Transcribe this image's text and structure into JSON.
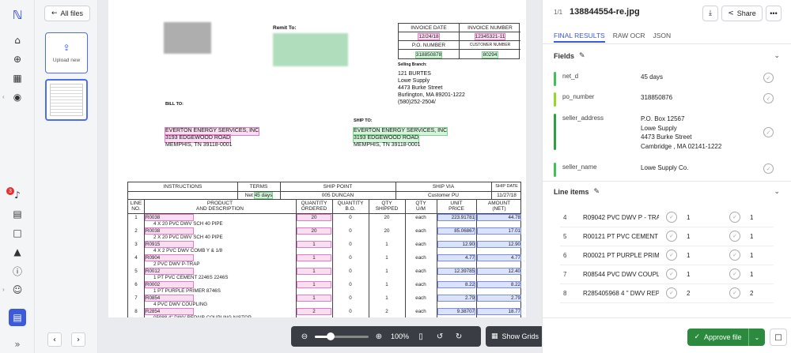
{
  "nav": {
    "notification_count": "3",
    "icons": [
      "logo-icon",
      "home-icon",
      "add-icon",
      "apps-icon",
      "compass-icon",
      "notification-icon",
      "book-icon",
      "feedback-icon",
      "rocket-icon",
      "help-icon",
      "account-icon",
      "document-icon",
      "expand-icon"
    ]
  },
  "files": {
    "all_files_label": "All files",
    "upload_label": "Upload new"
  },
  "toolbar": {
    "zoom_label": "100%",
    "zoom_level": 0.3,
    "show_grids_label": "Show Grids"
  },
  "document": {
    "remit_to_label": "Remit To:",
    "invoice_date_label": "INVOICE DATE",
    "invoice_number_label": "INVOICE NUMBER",
    "invoice_date": "12/24/18",
    "invoice_number": "12345321-11",
    "po_number_label": "P.O. NUMBER",
    "customer_number_label": "CUSTOMER NUMBER",
    "po_number": "318850878",
    "customer_number": "80294",
    "selling_branch_label": "Selling Branch:",
    "branch_lines": [
      "121 BURTES",
      "Lowe Supply",
      "4473  Burke Street",
      "Burlington, MA 89201-1222",
      "(580)252-2504/"
    ],
    "bill_to_label": "BILL TO:",
    "ship_to_label": "SHIP TO:",
    "bill_to_lines": [
      "EVERTON  ENERGY SERVICES, INC",
      "3193  EDGEWOOD ROAD",
      "MEMPHIS, TN 39118-0001"
    ],
    "ship_to_lines": [
      "EVERTON  ENERGY SERVICES, INC",
      "3193  EDGEWOOD ROAD",
      "MEMPHIS, TN 39118-0001"
    ],
    "header_row": {
      "instructions": "INSTRUCTIONS",
      "terms": "TERMS",
      "ship_point": "SHIP POINT",
      "ship_via": "SHIP VIA",
      "ship_date": "SHIP DATE",
      "terms_value_prefix": "Net ",
      "terms_value_days": "45 days",
      "ship_point_value": "005 DUNCAN",
      "ship_via_value": "Customer PU",
      "ship_date_value": "11/27/18"
    },
    "columns": {
      "line": "LINE\nNO.",
      "product": "PRODUCT\nAND DESCRIPTION",
      "qty_ordered": "QUANTITY\nORDERED",
      "qty_bo": "QUANTITY\nB.O.",
      "qty_shipped": "QTY\nSHIPPED",
      "qty_um": "QTY\nU/M",
      "unit_price": "UNIT\nPRICE",
      "amount": "AMOUNT\n(NET)"
    },
    "rows": [
      {
        "no": "1",
        "code": "R0038",
        "desc": "4 X 20 PVC DWV SCH 40 PIPE",
        "ordered": "20",
        "bo": "0",
        "shipped": "20",
        "um": "each",
        "price": "223.91781",
        "amount": "44.78"
      },
      {
        "no": "2",
        "code": "R0038",
        "desc": "2 X 20 PVC DWV SCH 40 PIPE",
        "ordered": "20",
        "bo": "0",
        "shipped": "20",
        "um": "each",
        "price": "85.06867",
        "amount": "17.01"
      },
      {
        "no": "3",
        "code": "R0915",
        "desc": "4 X 2 PVC DWV COMB Y & 1/8",
        "ordered": "1",
        "bo": "0",
        "shipped": "1",
        "um": "each",
        "price": "12.90",
        "amount": "12.90"
      },
      {
        "no": "4",
        "code": "R0904",
        "desc": "2 PVC DWV P-TRAP",
        "ordered": "1",
        "bo": "0",
        "shipped": "1",
        "um": "each",
        "price": "4.77",
        "amount": "4.77"
      },
      {
        "no": "5",
        "code": "R0012",
        "desc": "1 PT PVC CEMENT 2246S 2246S",
        "ordered": "1",
        "bo": "0",
        "shipped": "1",
        "um": "each",
        "price": "12.39785",
        "amount": "12.40"
      },
      {
        "no": "6",
        "code": "R0002",
        "desc": "1 PT PURPLE PRIMER 8746S",
        "ordered": "1",
        "bo": "0",
        "shipped": "1",
        "um": "each",
        "price": "8.22",
        "amount": "8.22"
      },
      {
        "no": "7",
        "code": "R0854",
        "desc": "4 PVC DWV COUPLING",
        "ordered": "1",
        "bo": "0",
        "shipped": "1",
        "um": "each",
        "price": "2.79",
        "amount": "2.79"
      },
      {
        "no": "8",
        "code": "R2854",
        "desc": "05988 4\" DWV REPAIR COUPLING N/STOP",
        "ordered": "2",
        "bo": "0",
        "shipped": "2",
        "um": "each",
        "price": "9.38707",
        "amount": "18.77"
      }
    ]
  },
  "panel": {
    "page_counter": "1/1",
    "file_name": "138844554-re.jpg",
    "share_label": "Share",
    "tabs": [
      "FINAL RESULTS",
      "RAW OCR",
      "JSON"
    ],
    "fields_title": "Fields",
    "fields": [
      {
        "key": "net_d",
        "value": "45 days",
        "color": "#40c057"
      },
      {
        "key": "po_number",
        "value": "318850876",
        "color": "#94d82d"
      },
      {
        "key": "seller_address",
        "value": "P.O. Box 12567\nLowe Supply\n4473 Burke Street\nCambridge , MA 02141-1222",
        "color": "#2f9e44"
      },
      {
        "key": "seller_name",
        "value": "Lowe Supply Co.",
        "color": "#40c057"
      }
    ],
    "line_items_title": "Line items",
    "line_items": [
      {
        "no": "4",
        "desc": "R09042 PVC DWV P - TRAP",
        "q1": "1",
        "q2": "1"
      },
      {
        "no": "5",
        "desc": "R00121 PT PVC CEMENT 2246S",
        "q1": "1",
        "q2": "1"
      },
      {
        "no": "6",
        "desc": "R00021 PT PURPLE PRIMER",
        "q1": "1",
        "q2": "1"
      },
      {
        "no": "7",
        "desc": "R08544 PVC DWV COUPLING",
        "q1": "1",
        "q2": "1"
      },
      {
        "no": "8",
        "desc": "R285405968 4 \" DWV REPAIR",
        "q1": "2",
        "q2": "2"
      }
    ],
    "approve_label": "Approve file"
  }
}
